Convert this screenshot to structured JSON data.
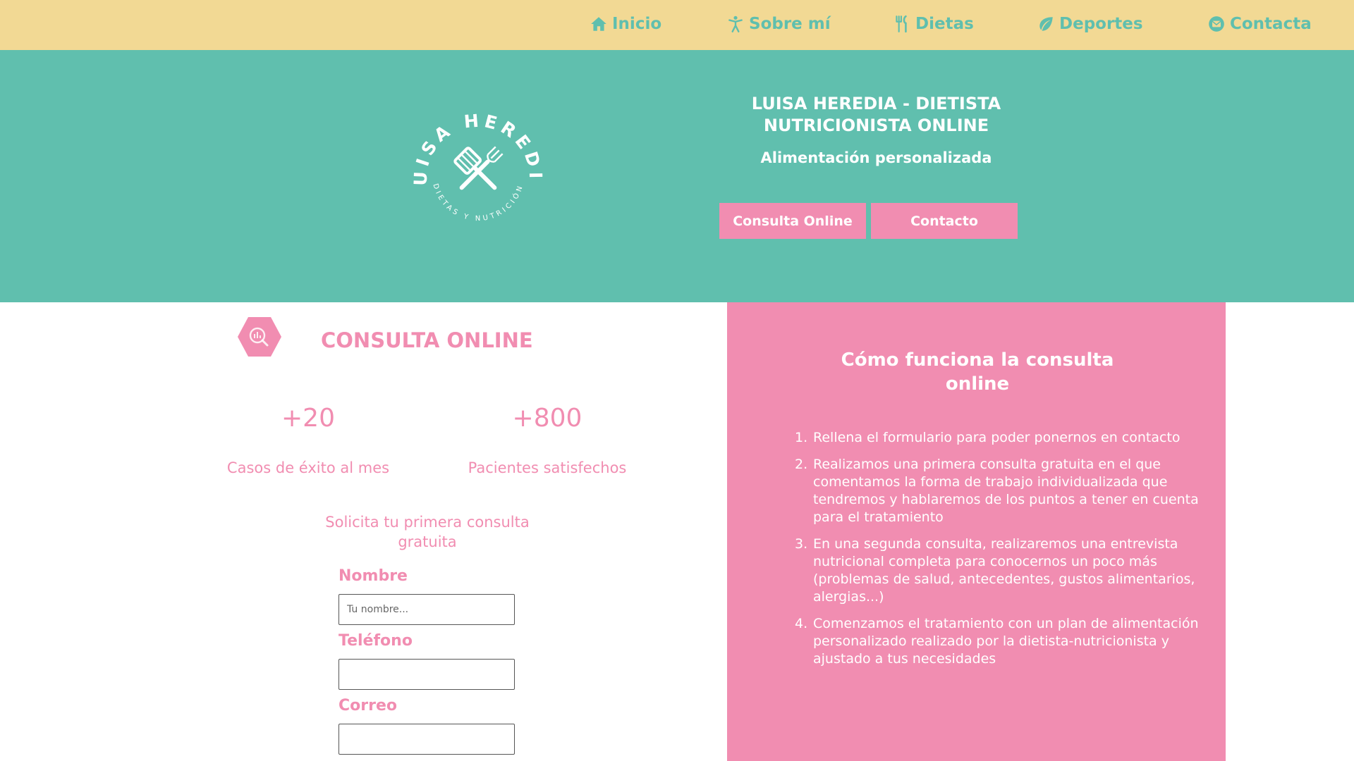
{
  "nav": {
    "items": [
      {
        "label": "Inicio",
        "icon": "home-icon"
      },
      {
        "label": "Sobre mí",
        "icon": "person-icon"
      },
      {
        "label": "Dietas",
        "icon": "utensils-icon"
      },
      {
        "label": "Deportes",
        "icon": "leaf-icon"
      },
      {
        "label": "Contacta",
        "icon": "envelope-icon"
      }
    ]
  },
  "hero": {
    "logo": {
      "name": "LUISA HEREDIA",
      "tagline": "DIETAS Y NUTRICIÓN"
    },
    "title": "LUISA HEREDIA - DIETISTA NUTRICIONISTA ONLINE",
    "subtitle": "Alimentación personalizada",
    "buttons": {
      "consulta": "Consulta Online",
      "contacto": "Contacto"
    }
  },
  "consulta": {
    "title": "CONSULTA ONLINE",
    "stats": [
      {
        "value": "+20",
        "label": "Casos de éxito al mes"
      },
      {
        "value": "+800",
        "label": "Pacientes satisfechos"
      }
    ],
    "cta": "Solicita tu primera consulta gratuita",
    "form": {
      "nombre_label": "Nombre",
      "nombre_placeholder": "Tu nombre...",
      "telefono_label": "Teléfono",
      "correo_label": "Correo"
    }
  },
  "how": {
    "title": "Cómo funciona la consulta online",
    "steps": [
      {
        "num": "1.",
        "text": "Rellena el formulario para poder ponernos en contacto"
      },
      {
        "num": "2.",
        "text": "Realizamos una primera consulta gratuita en el que comentamos la forma de trabajo individualizada que tendremos y hablaremos de los puntos a tener en cuenta para el tratamiento"
      },
      {
        "num": "3.",
        "text": "En una segunda consulta, realizaremos una entrevista nutricional completa para conocernos un poco más (problemas de salud, antecedentes, gustos alimentarios, alergias...)"
      },
      {
        "num": "4.",
        "text": "Comenzamos el tratamiento con un plan de alimentación personalizado realizado por la dietista-nutricionista y ajustado a tus necesidades"
      }
    ]
  },
  "colors": {
    "teal": "#60bfae",
    "yellow": "#f2d994",
    "pink": "#f18db1"
  }
}
